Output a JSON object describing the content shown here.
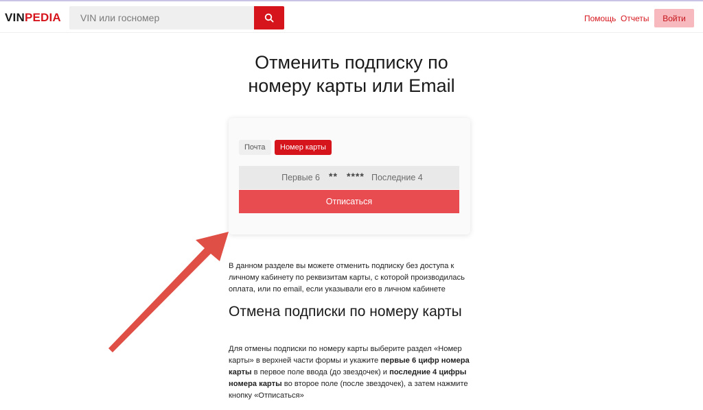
{
  "header": {
    "logo_part1": "VIN",
    "logo_part2": "PEDIA",
    "search_placeholder": "VIN или госномер",
    "search_icon": "search-icon",
    "nav_help": "Помощь",
    "nav_reports": "Отчеты",
    "login_label": "Войти"
  },
  "page": {
    "title_line1": "Отменить подписку по",
    "title_line2": "номеру карты или Email"
  },
  "form": {
    "tab_email": "Почта",
    "tab_card": "Номер карты",
    "first6_placeholder": "Первые 6",
    "mask_middle1": "**",
    "mask_middle2": "****",
    "last4_placeholder": "Последние 4",
    "submit_label": "Отписаться"
  },
  "content": {
    "intro": "В данном разделе вы можете отменить подписку без доступа к личному кабинету по реквизитам карты, с которой производилась оплата, или по email, если указывали его в личном кабинете",
    "h2": "Отмена подписки по номеру карты",
    "p_start": "Для отмены подписки по номеру карты выберите раздел «Номер карты» в верхней части формы и укажите ",
    "p_bold1": "первые 6 цифр номера карты",
    "p_mid": " в первое поле ввода (до звездочек) и ",
    "p_bold2": "последние 4 цифры номера карты",
    "p_end": " во второе поле (после звездочек), а затем нажмите кнопку «Отписаться»"
  },
  "colors": {
    "brand_red": "#d6141c",
    "submit_red": "#e84b50",
    "login_pink": "#f7b9bd",
    "arrow": "#df4f45"
  }
}
